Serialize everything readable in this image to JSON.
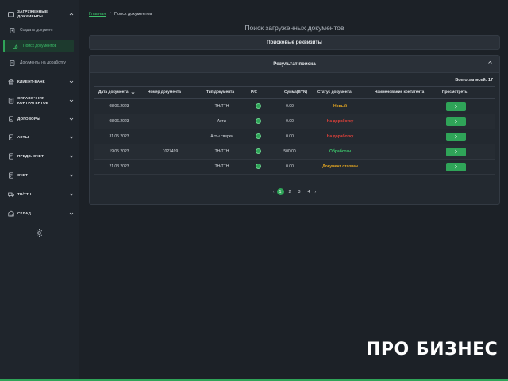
{
  "sidebar": {
    "groups": [
      {
        "label": "ЗАГРУЖЕННЫЕ ДОКУМЕНТЫ",
        "icon": "folder-icon",
        "expanded": true
      },
      {
        "label": "КЛИЕНТ-БАНК",
        "icon": "bank-icon"
      },
      {
        "label": "СПРАВОЧНИК КОНТРАГЕНТОВ",
        "icon": "book-icon"
      },
      {
        "label": "ДОГОВОРЫ",
        "icon": "contract-icon"
      },
      {
        "label": "АКТЫ",
        "icon": "act-icon"
      },
      {
        "label": "ПРЕДВ. СЧЕТ",
        "icon": "invoice-icon"
      },
      {
        "label": "СЧЕТ",
        "icon": "bill-icon"
      },
      {
        "label": "ТН/ТТН",
        "icon": "truck-icon"
      },
      {
        "label": "СКЛАД",
        "icon": "warehouse-icon"
      }
    ],
    "items": [
      {
        "label": "Создать документ",
        "icon": "create-doc-icon"
      },
      {
        "label": "Поиск документов",
        "icon": "search-doc-icon",
        "active": true
      },
      {
        "label": "Документы на доработку",
        "icon": "doc-rework-icon"
      }
    ],
    "settings_icon": "gear-icon"
  },
  "breadcrumb": {
    "home": "Главная",
    "separator": "/",
    "current": "Поиск документов"
  },
  "page_title": "Поиск загруженных документов",
  "search_panel": {
    "title": "Поисковые реквизиты"
  },
  "results_panel": {
    "title": "Результат поиска",
    "total": "Всего записей: 17",
    "columns": [
      "Дата документа",
      "Номер документа",
      "Тип документа",
      "Р/С",
      "Сумма(BYN)",
      "Статус документа",
      "Наименование контагента",
      "Просмотреть"
    ],
    "rows": [
      {
        "date": "08.06.2023",
        "number": "",
        "type": "ТН/ТТН",
        "amount": "0.00",
        "status": "Новый",
        "status_kind": "new",
        "counterparty": ""
      },
      {
        "date": "08.06.2023",
        "number": "",
        "type": "Акты",
        "amount": "0.00",
        "status": "На доработку",
        "status_kind": "rework",
        "counterparty": ""
      },
      {
        "date": "31.05.2023",
        "number": "",
        "type": "Акты сверки",
        "amount": "0.00",
        "status": "На доработку",
        "status_kind": "rework",
        "counterparty": ""
      },
      {
        "date": "19.05.2023",
        "number": "1027499",
        "type": "ТН/ТТН",
        "amount": "500.00",
        "status": "Обработан",
        "status_kind": "processed",
        "counterparty": ""
      },
      {
        "date": "21.03.2023",
        "number": "",
        "type": "ТН/ТТН",
        "amount": "0.00",
        "status": "Документ отозван",
        "status_kind": "recalled",
        "counterparty": ""
      }
    ]
  },
  "pager": {
    "prev": "‹",
    "pages": [
      "1",
      "2",
      "3",
      "4"
    ],
    "current": "1",
    "next": "›"
  },
  "brand": "ПРО БИЗНЕС",
  "colors": {
    "accent": "#2fa458",
    "status_new": "#e0a422",
    "status_rework": "#e0413a",
    "status_processed": "#3cc16a"
  }
}
